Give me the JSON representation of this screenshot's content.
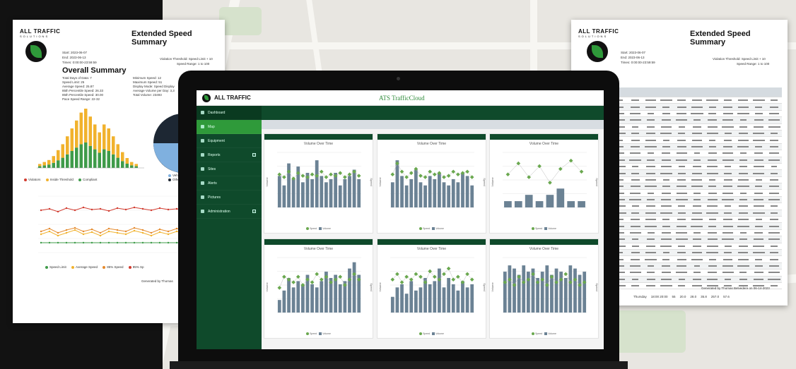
{
  "left_report": {
    "brand": "ALL TRAFFIC",
    "brand_sub": "SOLUTIONS",
    "title": "Extended Speed Summary",
    "meta": [
      "Start: 2023-06-07",
      "End: 2023-06-13",
      "Times: 0:00:00-23:59:59"
    ],
    "meta_right": "Violation Threshold: Speed Limit + 10",
    "meta_right2": "Speed Range: 1 to 100",
    "section": "Overall Summary",
    "stats_left": [
      "Total Days of Data: 7",
      "Speed Limit: 25",
      "Average Speed: 25.87",
      "85th Percentile Speed: 26.33",
      "85th Percentile Speed: 30.00",
      "Pace Speed Range: 22-32"
    ],
    "stats_right": [
      "Minimum Speed: 12",
      "Maximum Speed: 51",
      "Display Mode: Speed Display",
      "Average Volume per Day: 3,3",
      "Total Volume: 23493"
    ],
    "bar_legend": [
      "Violators",
      "Inside Threshold",
      "Compliant"
    ],
    "pie_legend": [
      "Vehicle",
      "Other"
    ],
    "line_legend": [
      "Speed Limit",
      "Average Speed",
      "85% Speed",
      "95% Sp"
    ],
    "footer": "Generated by Thomas"
  },
  "right_report": {
    "brand": "ALL TRAFFIC",
    "brand_sub": "SOLUTIONS",
    "title": "Extended Speed Summary",
    "meta": [
      "Start: 2023-06-07",
      "End: 2023-06-13",
      "Times: 0:00:00-23:59:59"
    ],
    "meta_right": "Violation Threshold: Speed Limit + 10",
    "meta_right2": "Speed Range: 1 to 100",
    "footer": "Generated by Thomas Belvedere on 06-14-2023",
    "summary_row": [
      "Thursday",
      "18:00 20:00",
      "55",
      "20.0",
      "28.0",
      "35.8",
      "257.0",
      "57.6"
    ]
  },
  "app": {
    "brand": "ALL TRAFFIC",
    "brand_sub": "SOLUTIONS",
    "title": "ATS TrafficCloud",
    "nav": [
      {
        "label": "Dashboard",
        "expand": false
      },
      {
        "label": "Map",
        "expand": false
      },
      {
        "label": "Equipment",
        "expand": false
      },
      {
        "label": "Reports",
        "expand": true
      },
      {
        "label": "Sites",
        "expand": false
      },
      {
        "label": "Alerts",
        "expand": false
      },
      {
        "label": "Pictures",
        "expand": false
      },
      {
        "label": "Administration",
        "expand": true
      }
    ],
    "card_title": "Volume Over Time",
    "legend_speed": "Speed",
    "legend_volume": "Volume",
    "y_left_label": "Volume",
    "y_right_label": "Speed"
  },
  "colors": {
    "brand_green": "#0f4a2b",
    "active_green": "#2f9a3a",
    "bar": "#6b8294",
    "speed_point": "#6aa84f"
  },
  "chart_data": [
    {
      "type": "bar",
      "title": "Volume Over Time",
      "values": [
        20,
        14,
        28,
        18,
        26,
        16,
        22,
        18,
        30,
        20,
        16,
        18,
        22,
        14,
        18,
        20,
        24,
        18
      ],
      "speed": [
        24,
        22,
        26,
        21,
        25,
        23,
        22,
        24,
        23,
        26,
        22,
        24,
        23,
        25,
        22,
        24,
        26,
        23
      ]
    },
    {
      "type": "bar",
      "title": "Volume Over Time",
      "values": [
        16,
        30,
        20,
        14,
        18,
        24,
        16,
        14,
        20,
        18,
        22,
        16,
        14,
        18,
        16,
        22,
        20,
        14
      ],
      "speed": [
        24,
        32,
        26,
        22,
        25,
        28,
        23,
        22,
        26,
        24,
        25,
        22,
        23,
        26,
        24,
        25,
        26,
        22
      ]
    },
    {
      "type": "bar",
      "title": "Volume Over Time",
      "values": [
        4,
        4,
        8,
        4,
        8,
        12,
        4,
        4
      ],
      "speed": [
        24,
        32,
        22,
        30,
        18,
        28,
        34,
        26
      ]
    },
    {
      "type": "bar",
      "title": "Volume Over Time",
      "values": [
        8,
        14,
        22,
        16,
        20,
        18,
        24,
        18,
        16,
        20,
        26,
        22,
        24,
        18,
        20,
        28,
        32,
        24
      ],
      "speed": [
        18,
        26,
        24,
        22,
        26,
        20,
        24,
        22,
        28,
        24,
        26,
        22,
        24,
        26,
        20,
        24,
        28,
        24
      ]
    },
    {
      "type": "bar",
      "title": "Volume Over Time",
      "values": [
        10,
        16,
        18,
        12,
        20,
        14,
        16,
        22,
        18,
        20,
        28,
        16,
        22,
        18,
        14,
        20,
        16,
        18
      ],
      "speed": [
        24,
        28,
        22,
        26,
        24,
        28,
        26,
        22,
        30,
        26,
        24,
        28,
        32,
        24,
        26,
        22,
        28,
        24
      ]
    },
    {
      "type": "bar",
      "title": "Volume Over Time",
      "values": [
        26,
        30,
        28,
        24,
        30,
        26,
        28,
        22,
        26,
        30,
        24,
        28,
        26,
        22,
        30,
        28,
        24,
        26
      ],
      "speed": [
        22,
        24,
        20,
        26,
        22,
        24,
        28,
        22,
        24,
        20,
        26,
        22,
        24,
        28,
        22,
        24,
        20,
        22
      ]
    }
  ]
}
